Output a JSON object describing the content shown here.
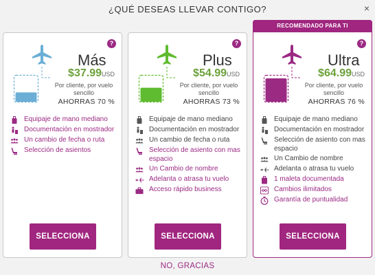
{
  "header": {
    "title": "¿QUÉ DESEAS LLEVAR CONTIGO?",
    "close_label": "×"
  },
  "plans": [
    {
      "name": "Más",
      "price": "$37.99",
      "currency": "USD",
      "per_client": "Por cliente, por vuelo sencillo",
      "savings": "AHORRAS 70 %",
      "accent": "#6aaed6",
      "bag_fill": 0.4,
      "features": [
        {
          "text": "Equipaje de mano mediano",
          "icon": "carry-on-icon",
          "highlight": true
        },
        {
          "text": "Documentación en mostrador",
          "icon": "counter-checkin-icon",
          "highlight": true
        },
        {
          "text": "Un cambio de fecha o ruta",
          "icon": "people-icon",
          "highlight": true
        },
        {
          "text": "Selección de asientos",
          "icon": "seat-icon",
          "highlight": true
        }
      ],
      "button": "SELECCIONA"
    },
    {
      "name": "Plus",
      "price": "$54.99",
      "currency": "USD",
      "per_client": "Por cliente, por vuelo sencillo",
      "savings": "AHORRAS 73 %",
      "accent": "#5fbb2f",
      "bag_fill": 0.6,
      "features": [
        {
          "text": "Equipaje de mano mediano",
          "icon": "carry-on-icon",
          "highlight": false
        },
        {
          "text": "Documentación en mostrador",
          "icon": "counter-checkin-icon",
          "highlight": false
        },
        {
          "text": "Un cambio de fecha o ruta",
          "icon": "people-icon",
          "highlight": false
        },
        {
          "text": "Selección de asiento con mas espacio",
          "icon": "seat-icon",
          "highlight": true
        },
        {
          "text": "Un Cambio de nombre",
          "icon": "people-icon",
          "highlight": true
        },
        {
          "text": "Adelanta o atrasa tu vuelo",
          "icon": "flight-change-icon",
          "highlight": true
        },
        {
          "text": "Acceso rápido business",
          "icon": "briefcase-icon",
          "highlight": true
        }
      ],
      "button": "SELECCIONA"
    },
    {
      "name": "Ultra",
      "price": "$64.99",
      "currency": "USD",
      "per_client": "Por cliente, por vuelo sencillo",
      "savings": "AHORRAS 76 %",
      "accent": "#9b2a83",
      "bag_fill": 1.0,
      "recommended": "RECOMENDADO PARA TI",
      "features": [
        {
          "text": "Equipaje de mano mediano",
          "icon": "carry-on-icon",
          "highlight": false
        },
        {
          "text": "Documentación en mostrador",
          "icon": "counter-checkin-icon",
          "highlight": false
        },
        {
          "text": "Selección de asiento con mas espacio",
          "icon": "seat-icon",
          "highlight": false
        },
        {
          "text": "Un Cambio de nombre",
          "icon": "people-icon",
          "highlight": false
        },
        {
          "text": "Adelanta o atrasa tu vuelo",
          "icon": "flight-change-icon",
          "highlight": false
        },
        {
          "text": "1 maleta documentada",
          "icon": "suitcase-icon",
          "highlight": true
        },
        {
          "text": "Cambios ilimitados",
          "icon": "unlimited-icon",
          "highlight": true
        },
        {
          "text": "Garantía de puntualidad",
          "icon": "clock-icon",
          "highlight": true
        }
      ],
      "button": "SELECCIONA"
    }
  ],
  "help_label": "?",
  "footer": {
    "no_thanks": "NO, GRACIAS"
  }
}
